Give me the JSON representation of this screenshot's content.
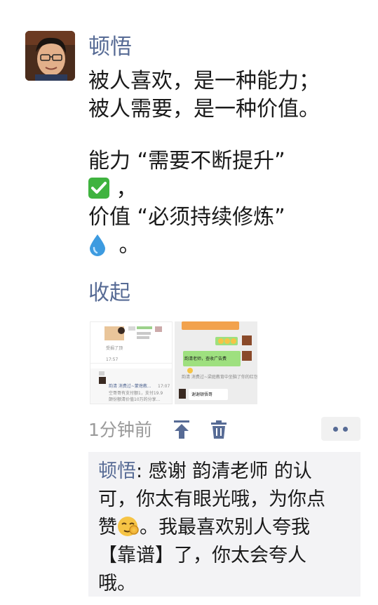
{
  "post": {
    "author": "顿悟",
    "lines": [
      "被人喜欢，是一种能力；",
      "被人需要，是一种价值。",
      "能力 “需要不断提升”",
      "，",
      "价值 “必须持续修炼”",
      "。"
    ],
    "collapse_label": "收起",
    "time": "1分钟前"
  },
  "thumbnails": {
    "thumb1": {
      "small_text_1": "受捐了顶",
      "time": "17:57",
      "name": "韵清 消费过~蒙熄教...",
      "time2": "17:07",
      "line2": "空哥哥有支付额1，支付19.9",
      "line3": "颠份额清价值10万的分享..."
    },
    "thumb2": {
      "bubble_text": "韵清老师，查收广告费",
      "reply_text": "韵清 消费过~梁庭教育中坐脑了你的红包",
      "thanks_text": "谢谢顿悟哥"
    }
  },
  "comment": {
    "name": "顿悟",
    "lines": [
      ": 感谢 韵清老师 的认",
      "可，你太有眼光哦，为你点",
      "赞",
      "。我最喜欢别人夸我",
      "【靠谱】了，你太会夸人",
      "哦。"
    ]
  },
  "icons": {
    "check": "check-mark-button-emoji",
    "drop": "droplet-emoji",
    "face": "okay-hand-face-emoji",
    "pin": "pin-to-top-icon",
    "trash": "trash-icon",
    "more": "more-dots-icon"
  },
  "colors": {
    "link_blue": "#576b95",
    "text": "#1a1a1a",
    "meta_gray": "#9a9a9a",
    "comment_bg": "#f3f3f5"
  }
}
